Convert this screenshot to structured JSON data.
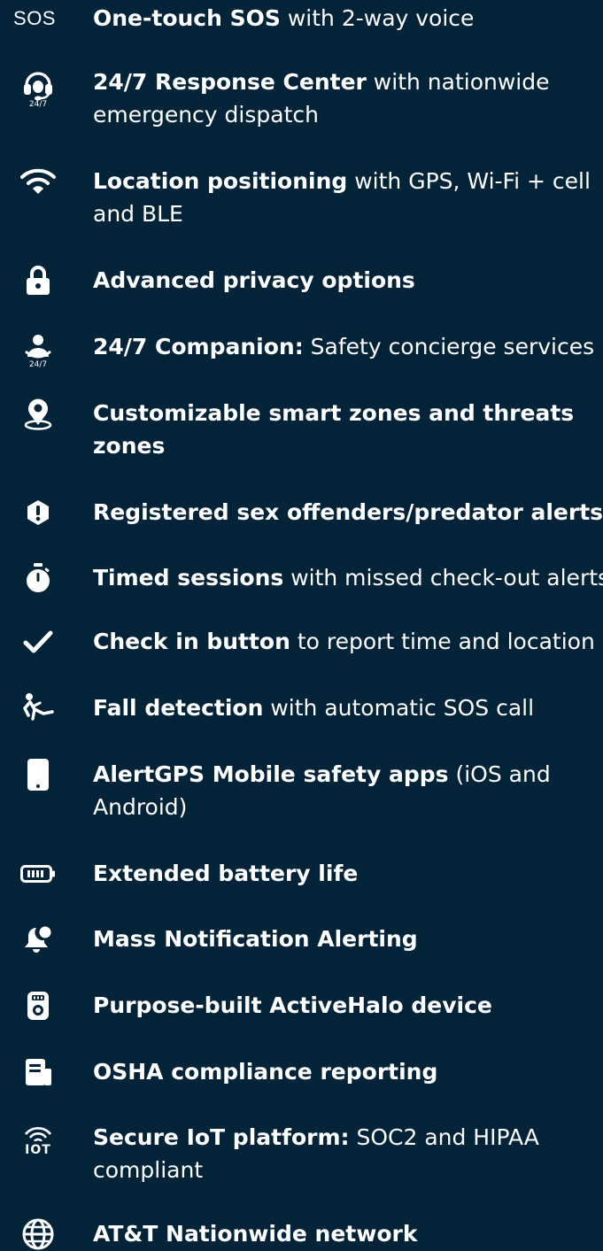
{
  "background_color": "#022338",
  "text_color": "#ffffff",
  "features": [
    {
      "icon": "sos-icon",
      "icon_text": "SOS",
      "bold": "One-touch SOS",
      "rest": " with 2-way voice",
      "line2": ""
    },
    {
      "icon": "headset-24-7-icon",
      "icon_text": "24/7",
      "bold": "24/7 Response Center",
      "rest": " with nationwide",
      "line2": "emergency dispatch"
    },
    {
      "icon": "wifi-icon",
      "icon_text": "",
      "bold": "Location positioning",
      "rest": " with GPS, Wi-Fi + cell",
      "line2": "and BLE"
    },
    {
      "icon": "lock-icon",
      "icon_text": "",
      "bold": "Advanced privacy options",
      "rest": "",
      "line2": ""
    },
    {
      "icon": "companion-24-7-icon",
      "icon_text": "24/7",
      "bold": "24/7 Companion:",
      "rest": " Safety concierge services",
      "line2": ""
    },
    {
      "icon": "location-pin-icon",
      "icon_text": "",
      "bold": "Customizable smart zones and threats",
      "rest": "",
      "line2": "zones"
    },
    {
      "icon": "alert-shield-icon",
      "icon_text": "",
      "bold": "Registered sex offenders/predator alerts",
      "rest": "",
      "line2": ""
    },
    {
      "icon": "stopwatch-icon",
      "icon_text": "",
      "bold": "Timed sessions",
      "rest": " with missed check-out alerts",
      "line2": ""
    },
    {
      "icon": "checkmark-icon",
      "icon_text": "",
      "bold": "Check in button",
      "rest": " to report time and location",
      "line2": ""
    },
    {
      "icon": "falling-person-icon",
      "icon_text": "",
      "bold": "Fall detection",
      "rest": " with automatic SOS call",
      "line2": ""
    },
    {
      "icon": "mobile-phone-icon",
      "icon_text": "",
      "bold": "AlertGPS Mobile safety apps",
      "rest": " (iOS and",
      "line2": "Android)"
    },
    {
      "icon": "battery-icon",
      "icon_text": "",
      "bold": "Extended battery life",
      "rest": "",
      "line2": ""
    },
    {
      "icon": "notification-bell-icon",
      "icon_text": "",
      "bold": "Mass Notification Alerting",
      "rest": "",
      "line2": ""
    },
    {
      "icon": "device-icon",
      "icon_text": "",
      "bold": "Purpose-built ActiveHalo device",
      "rest": "",
      "line2": ""
    },
    {
      "icon": "report-document-icon",
      "icon_text": "",
      "bold": "OSHA compliance reporting",
      "rest": "",
      "line2": ""
    },
    {
      "icon": "iot-icon",
      "icon_text": "IOT",
      "bold": "Secure IoT platform:",
      "rest": " SOC2 and HIPAA",
      "line2": "compliant"
    },
    {
      "icon": "globe-icon",
      "icon_text": "",
      "bold": "AT&T Nationwide network",
      "rest": "",
      "line2": ""
    }
  ]
}
